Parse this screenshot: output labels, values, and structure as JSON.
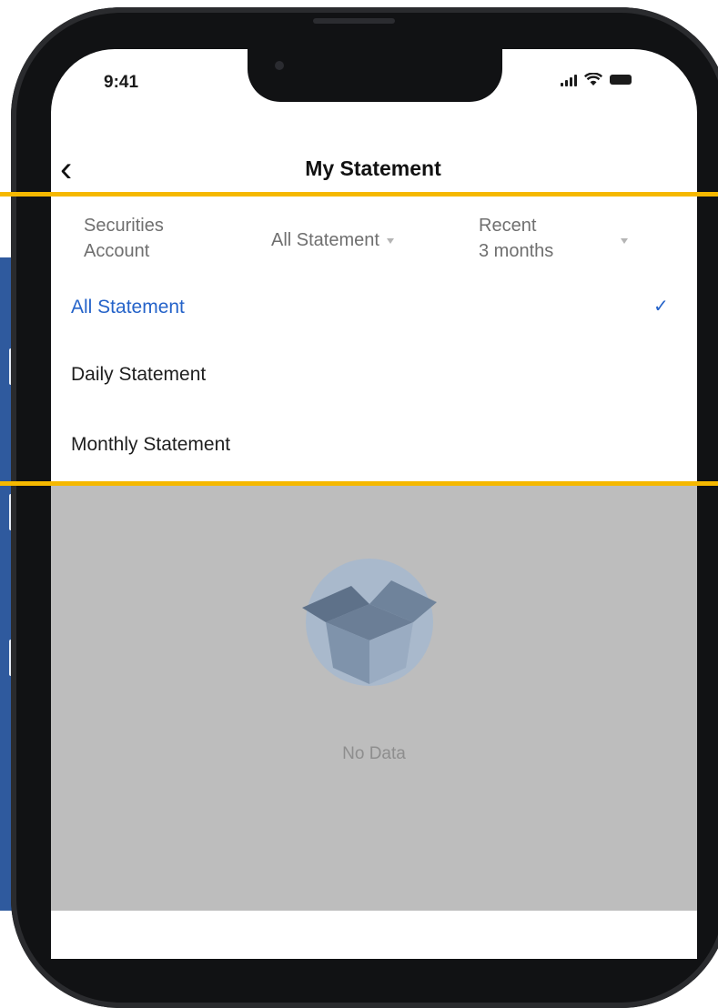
{
  "status_bar": {
    "time": "9:41"
  },
  "nav": {
    "title": "My Statement"
  },
  "filters": {
    "account": {
      "line1": "Securities",
      "line2": "Account"
    },
    "statement_type": {
      "label": "All Statement"
    },
    "period": {
      "line1": "Recent",
      "line2": "3 months"
    }
  },
  "dropdown": {
    "options": [
      {
        "label": "All Statement",
        "selected": true
      },
      {
        "label": "Daily Statement",
        "selected": false
      },
      {
        "label": "Monthly Statement",
        "selected": false
      }
    ],
    "check_glyph": "✓"
  },
  "empty_state": {
    "text": "No Data"
  },
  "colors": {
    "accent": "#2563c9",
    "highlight_lines": "#f5b800",
    "overlay": "#bdbdbd",
    "side_panel": "#2f5a9e"
  },
  "icons": [
    "back-chevron-icon",
    "signal-icon",
    "wifi-icon",
    "battery-icon",
    "caret-down-icon",
    "check-icon",
    "empty-box-icon"
  ]
}
